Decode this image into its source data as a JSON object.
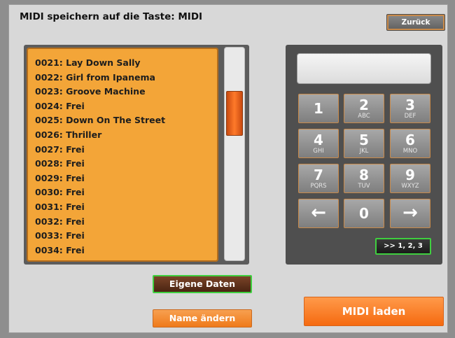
{
  "header": {
    "title": "MIDI speichern auf die Taste: MIDI",
    "back_label": "Zurück"
  },
  "list": {
    "items": [
      "0021: Lay Down Sally",
      "0022: Girl from Ipanema",
      "0023: Groove Machine",
      "0024: Frei",
      "0025: Down On The Street",
      "0026: Thriller",
      "0027: Frei",
      "0028: Frei",
      "0029: Frei",
      "0030: Frei",
      "0031: Frei",
      "0032: Frei",
      "0033: Frei",
      "0034: Frei"
    ]
  },
  "keypad": {
    "display_value": "",
    "keys": [
      {
        "digit": "1",
        "letters": ""
      },
      {
        "digit": "2",
        "letters": "ABC"
      },
      {
        "digit": "3",
        "letters": "DEF"
      },
      {
        "digit": "4",
        "letters": "GHI"
      },
      {
        "digit": "5",
        "letters": "JKL"
      },
      {
        "digit": "6",
        "letters": "MNO"
      },
      {
        "digit": "7",
        "letters": "PQRS"
      },
      {
        "digit": "8",
        "letters": "TUV"
      },
      {
        "digit": "9",
        "letters": "WXYZ"
      },
      {
        "digit": "←",
        "letters": ""
      },
      {
        "digit": "0",
        "letters": ""
      },
      {
        "digit": "→",
        "letters": ""
      }
    ],
    "mode_label": ">> 1, 2, 3"
  },
  "buttons": {
    "eigene_daten": "Eigene Daten",
    "name_aendern": "Name ändern",
    "midi_laden": "MIDI laden"
  },
  "colors": {
    "accent": "#f07a22",
    "list_bg": "#f3a538",
    "active_border": "#3fcf3f"
  }
}
